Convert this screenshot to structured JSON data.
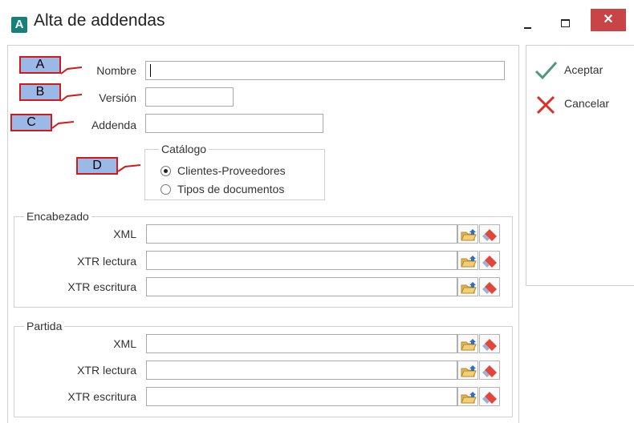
{
  "window": {
    "title": "Alta de addendas",
    "app_icon_letter": "A",
    "close_glyph": "✕"
  },
  "annotations": [
    "A",
    "B",
    "C",
    "D"
  ],
  "form": {
    "nombre_label": "Nombre",
    "version_label": "Versión",
    "addenda_label": "Addenda",
    "nombre_value": "",
    "version_value": "",
    "addenda_value": ""
  },
  "catalogo": {
    "title": "Catálogo",
    "options": [
      {
        "label": "Clientes-Proveedores",
        "selected": true
      },
      {
        "label": "Tipos de documentos",
        "selected": false
      }
    ]
  },
  "encabezado": {
    "title": "Encabezado",
    "rows": [
      {
        "label": "XML",
        "value": ""
      },
      {
        "label": "XTR lectura",
        "value": ""
      },
      {
        "label": "XTR escritura",
        "value": ""
      }
    ]
  },
  "partida": {
    "title": "Partida",
    "rows": [
      {
        "label": "XML",
        "value": ""
      },
      {
        "label": "XTR lectura",
        "value": ""
      },
      {
        "label": "XTR escritura",
        "value": ""
      }
    ]
  },
  "actions": {
    "accept_label": "Aceptar",
    "cancel_label": "Cancelar"
  },
  "icons": {
    "accept": "checkmark-icon",
    "cancel": "x-icon",
    "browse": "folder-open-icon",
    "clear": "eraser-icon"
  },
  "colors": {
    "accent": "#16817a",
    "close_button": "#c94545",
    "annotation_fill": "#9bb9e6",
    "annotation_border": "#d11a1a",
    "accept_icon": "#4a9b7a",
    "cancel_icon": "#d9302a"
  }
}
